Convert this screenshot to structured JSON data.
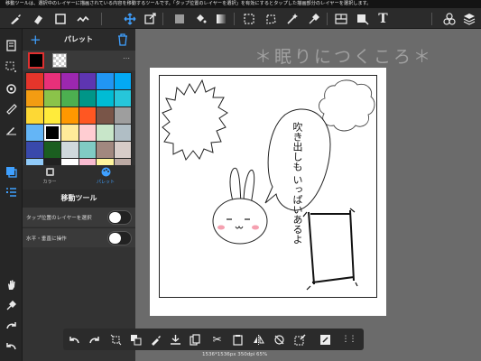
{
  "hint_text": "移動ツールは、選択中のレイヤーに描画されている内容を移動するツールです。「タップ位置のレイヤーを選択」を有効にするとタップした描画部分のレイヤーを選択します。",
  "palette": {
    "title": "パレット",
    "add_icon": "plus-icon",
    "delete_icon": "trash-icon",
    "main_color": "#000000",
    "main_border": "#e03030",
    "more_label": "⋯",
    "colors": [
      "#e5352b",
      "#e8307a",
      "#9c27b0",
      "#5e35b1",
      "#2196f3",
      "#03a9f4",
      "#f39c12",
      "#8bc34a",
      "#4caf50",
      "#009688",
      "#00bcd4",
      "#26c6da",
      "#fdd835",
      "#ffeb3b",
      "#ff9800",
      "#ff5722",
      "#795548",
      "#9e9e9e",
      "#64b5f6",
      "#000000",
      "#ffeb99",
      "#ffcdd2",
      "#c8e6c9",
      "#b0bec5",
      "#3949ab",
      "#1b5e20",
      "#cfd8dc",
      "#80cbc4",
      "#a1887f",
      "#d7ccc8",
      "#90caf9",
      "#212121",
      "#ffffff",
      "#f8bbd0",
      "#fff59d",
      "#bcaaa4"
    ],
    "selected_index": 19
  },
  "modes": [
    {
      "label": "カラー",
      "icon": "color-square-icon",
      "active": false
    },
    {
      "label": "パレット",
      "icon": "palette-icon",
      "active": true
    }
  ],
  "tool": {
    "title": "移動ツール",
    "options": [
      {
        "label": "タップ位置のレイヤーを選択",
        "on": false
      },
      {
        "label": "水平・垂直に操作",
        "on": false
      }
    ]
  },
  "watermark": "＊眠りにつくころ＊",
  "bubble_text": "吹き出しも いっぱいあるよ",
  "status": "1536*1536px 350dpi 65%",
  "accent": "#3fa0ff"
}
